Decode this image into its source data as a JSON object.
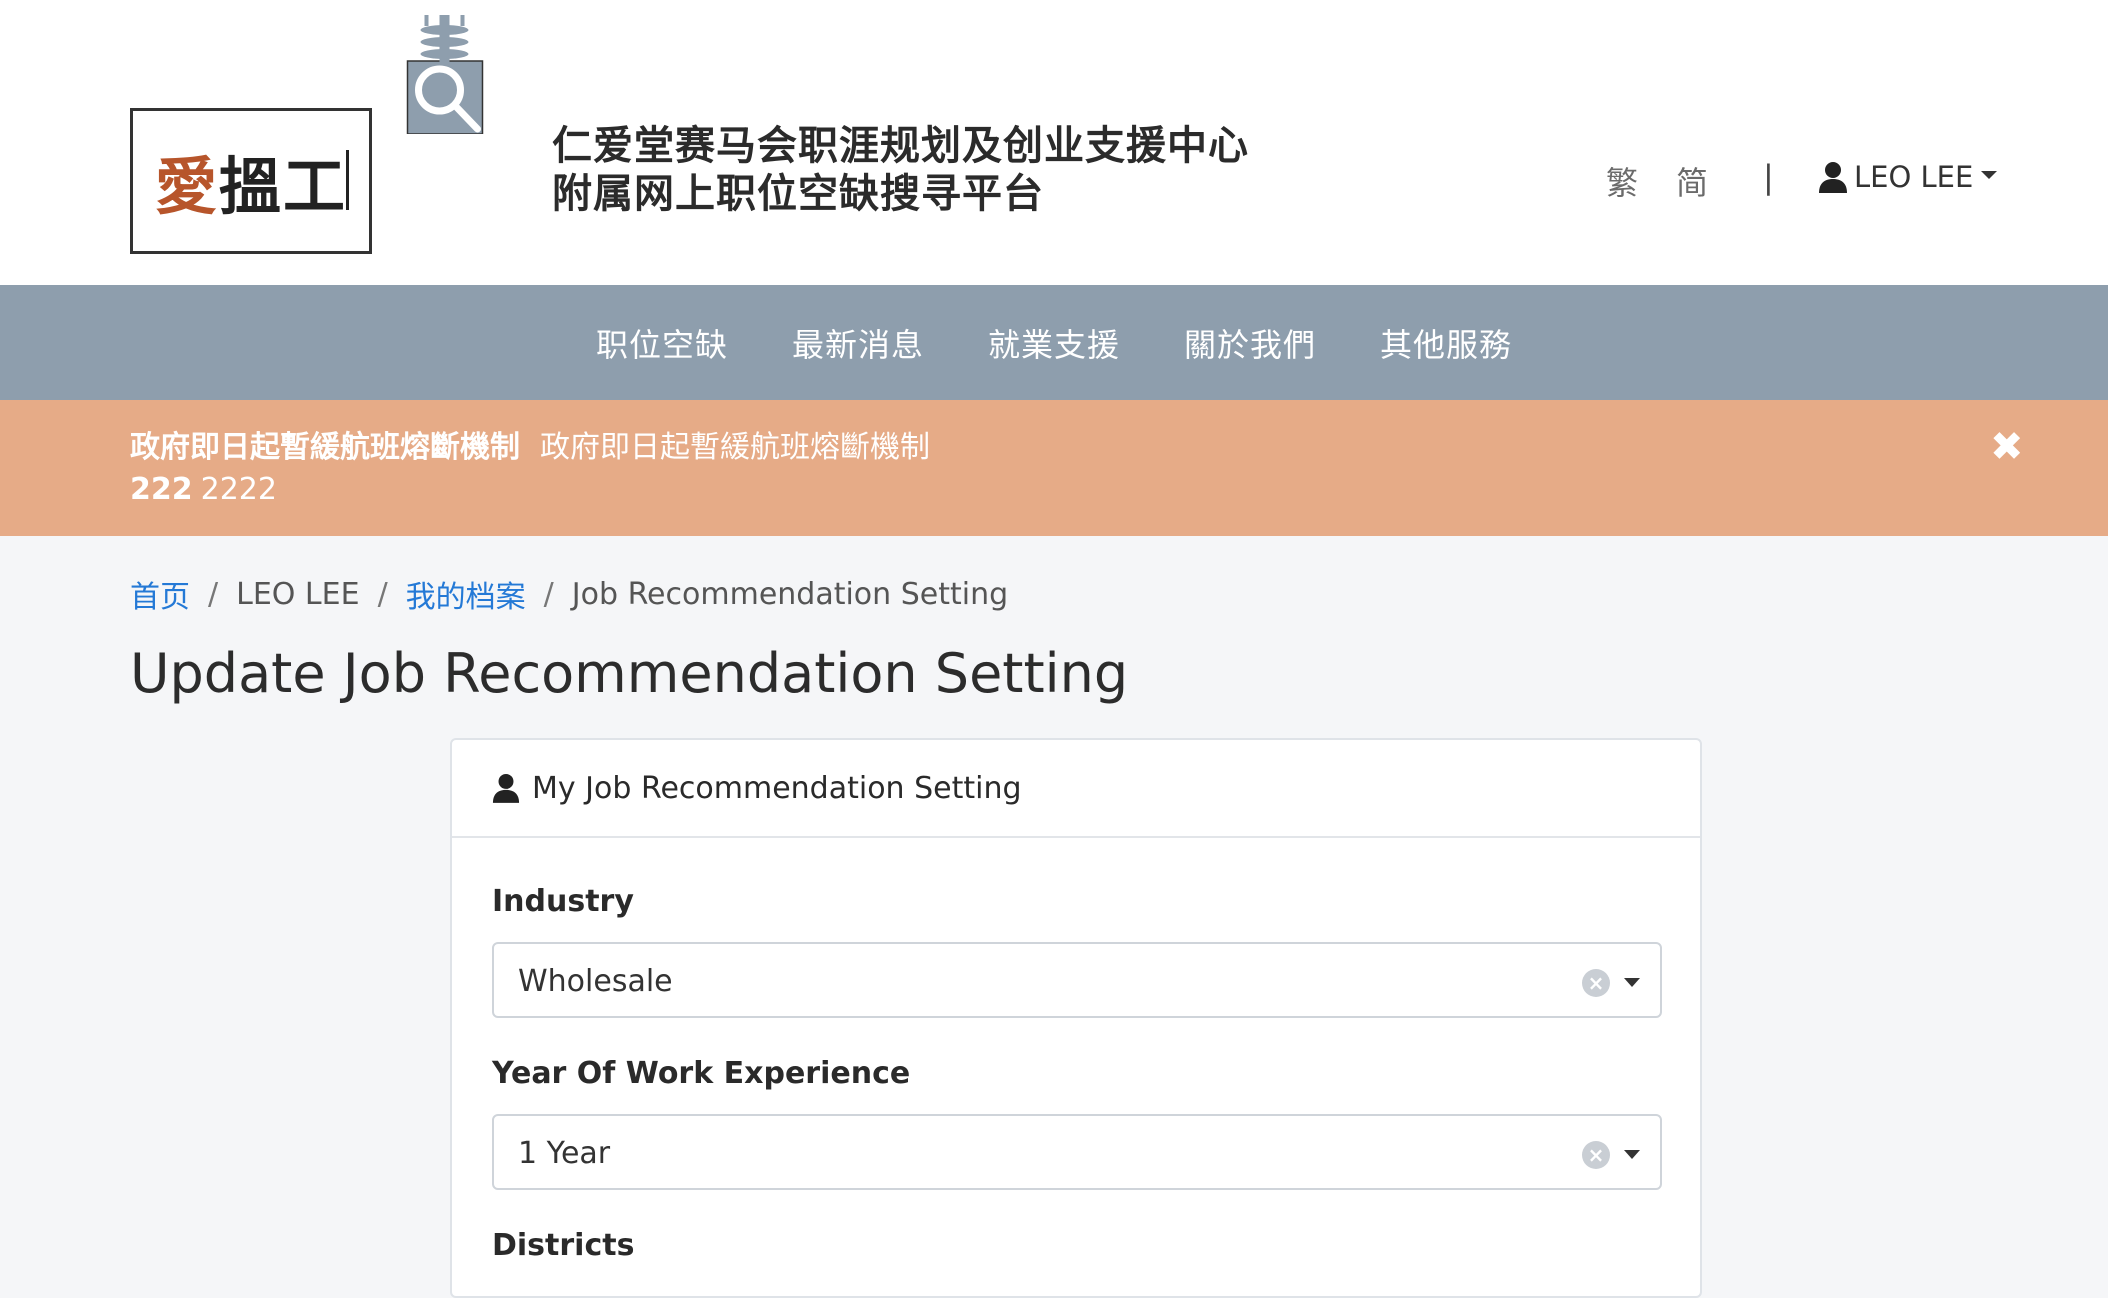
{
  "header": {
    "logo_text_ai": "愛",
    "logo_text_rest": "搵工",
    "site_title_line1": "仁爱堂赛马会职涯规划及创业支援中心",
    "site_title_line2": "附属网上职位空缺搜寻平台",
    "lang_traditional": "繁",
    "lang_simplified": "简",
    "lang_separator": "|",
    "user_name": "LEO LEE"
  },
  "nav": {
    "items": [
      {
        "label": "职位空缺"
      },
      {
        "label": "最新消息"
      },
      {
        "label": "就業支援"
      },
      {
        "label": "關於我們"
      },
      {
        "label": "其他服務"
      }
    ]
  },
  "alert": {
    "title": "政府即日起暫緩航班熔斷機制",
    "message": "政府即日起暫緩航班熔斷機制",
    "line2_strong": "222",
    "line2_text": "2222",
    "close_symbol": "✖"
  },
  "breadcrumb": {
    "home": "首页",
    "user": "LEO LEE",
    "profile": "我的档案",
    "current": "Job Recommendation Setting",
    "separator": "/"
  },
  "page_title": "Update Job Recommendation Setting",
  "card": {
    "header_title": "My Job Recommendation Setting",
    "fields": {
      "industry_label": "Industry",
      "industry_value": "Wholesale",
      "experience_label": "Year Of Work Experience",
      "experience_value": "1 Year",
      "districts_label": "Districts"
    }
  },
  "colors": {
    "nav_bg": "#8e9ead",
    "alert_bg": "#e6ab87",
    "link": "#2479d6",
    "logo_accent": "#b7552b"
  },
  "icons": {
    "user": "person-icon",
    "close": "close-icon",
    "clear": "clear-circle-icon",
    "caret": "caret-down-icon"
  }
}
